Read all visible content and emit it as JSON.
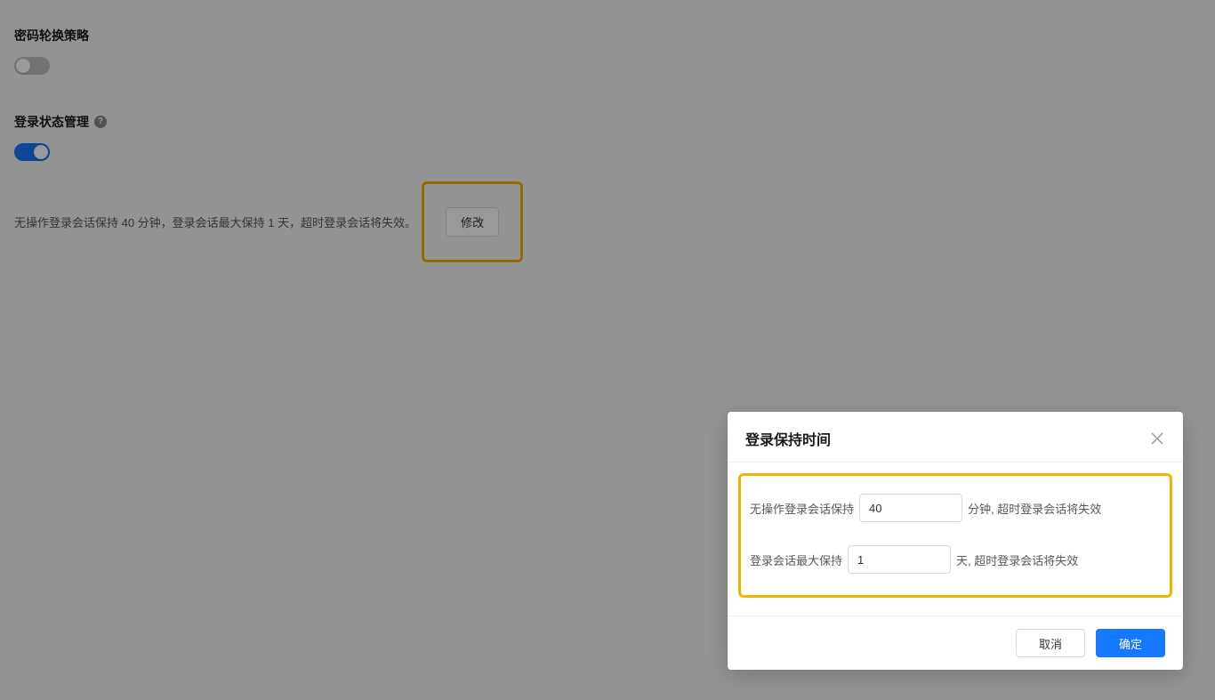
{
  "sections": {
    "password_rotation": {
      "title": "密码轮换策略",
      "enabled": false
    },
    "login_state": {
      "title": "登录状态管理",
      "enabled": true,
      "description": "无操作登录会话保持 40 分钟，登录会话最大保持 1 天，超时登录会话将失效。",
      "modify_label": "修改"
    }
  },
  "modal": {
    "title": "登录保持时间",
    "fields": {
      "idle": {
        "prefix": "无操作登录会话保持",
        "value": "40",
        "suffix": "分钟, 超时登录会话将失效"
      },
      "max": {
        "prefix": "登录会话最大保持",
        "value": "1",
        "suffix": "天, 超时登录会话将失效"
      }
    },
    "buttons": {
      "cancel": "取消",
      "confirm": "确定"
    }
  }
}
